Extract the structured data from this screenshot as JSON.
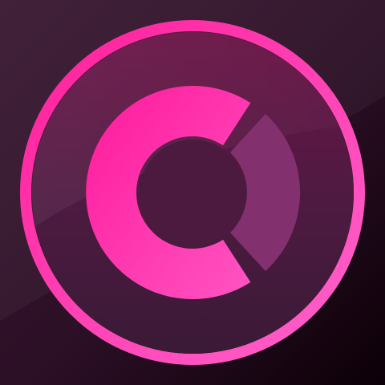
{
  "icon": {
    "name": "donut-chart-app-icon",
    "colors": {
      "background_top": "#3a1832",
      "background_bottom": "#100009",
      "ring": "#ff4fc0",
      "disc": "#4a1a3e",
      "arc_main": "#ff2ea6",
      "arc_segment": "#83306e",
      "center_hole": "#4d1a3f"
    }
  }
}
